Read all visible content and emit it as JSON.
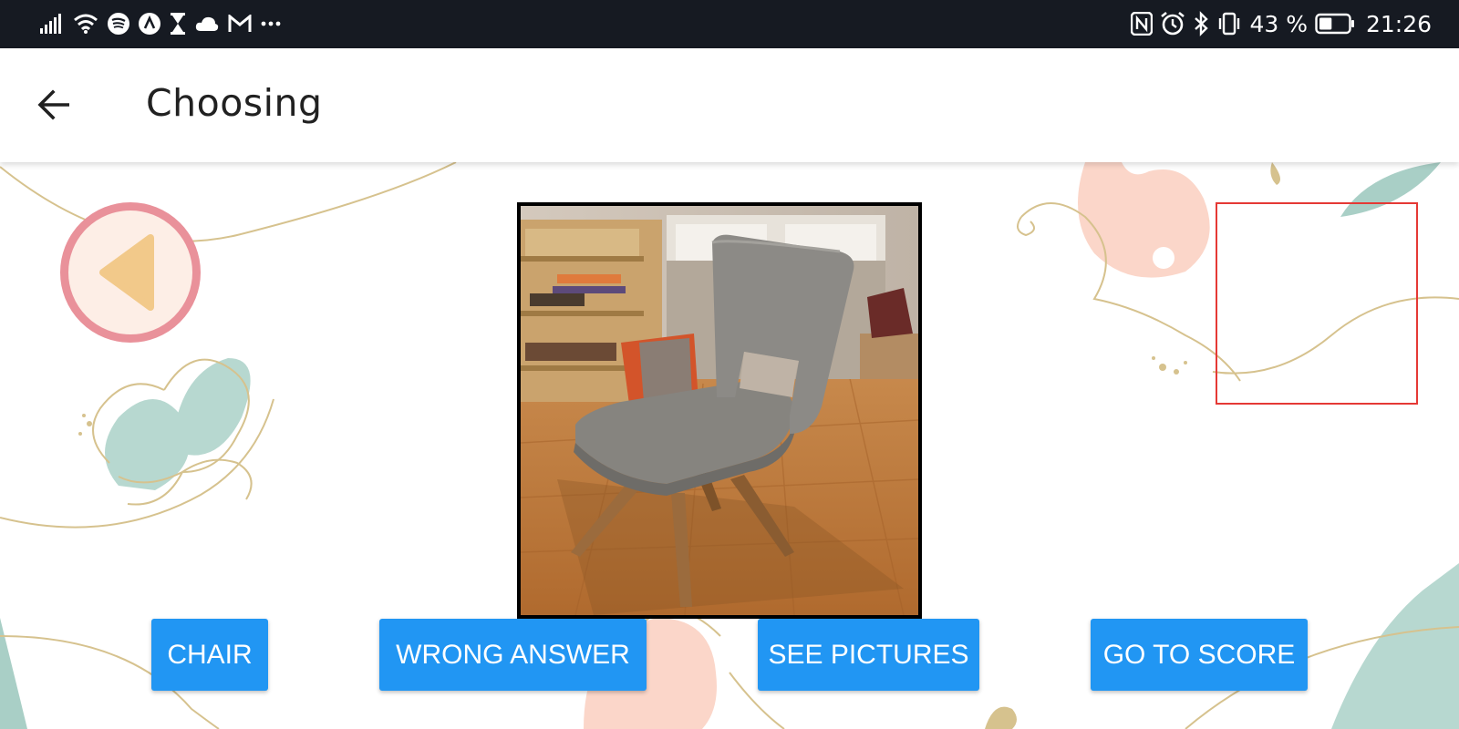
{
  "status_bar": {
    "battery_percent": "43 %",
    "time": "21:26",
    "left_icons": [
      "signal-icon",
      "wifi-icon",
      "spotify-icon",
      "app-icon",
      "hourglass-icon",
      "cloud-icon",
      "gmail-icon",
      "more-icon"
    ],
    "right_icons": [
      "nfc-icon",
      "alarm-icon",
      "bluetooth-icon",
      "vibrate-icon",
      "battery-icon"
    ],
    "battery_level": 0.43
  },
  "app_bar": {
    "title": "Choosing"
  },
  "buttons": {
    "chair": "CHAIR",
    "wrong_answer": "WRONG ANSWER",
    "see_pictures": "SEE PICTURES",
    "go_to_score": "GO TO SCORE"
  },
  "colors": {
    "status_bar_bg": "#161a22",
    "button_blue": "#2196f3",
    "prev_ring": "#e9919a",
    "prev_fill": "#fdeee6",
    "prev_arrow": "#f2c98a",
    "target_box_border": "#e53935"
  }
}
